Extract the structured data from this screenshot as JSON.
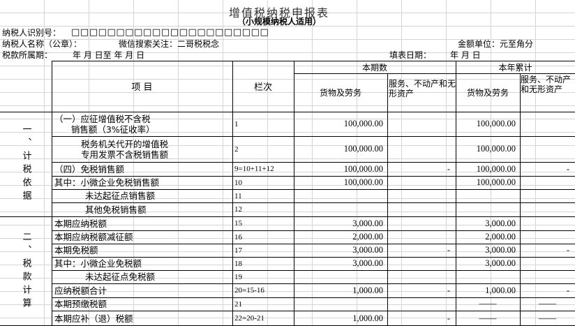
{
  "form": {
    "title": "增值税纳税申报表",
    "subtitle": "（小规模纳税人适用）",
    "taxpayer_id_label": "纳税人识别号：",
    "taxpayer_id_boxes": "□□□□□□□□□□□□□□□□□□□□□□",
    "taxpayer_name_label": "纳税人名称（公章）：",
    "wechat_note": "微信搜索关注：二哥税税念",
    "unit_label": "金额单位：元至角分",
    "period_label": "税款所属期：",
    "period_value": "年  月  日至   年  月  日",
    "fill_date_label": "填表日期：",
    "fill_date_value": "年  月  日"
  },
  "table": {
    "header_item": "项    目",
    "header_line": "栏次",
    "header_current": "本期数",
    "header_ytd": "本年累计",
    "col_goods": "货物及劳务",
    "col_services": "服务、不动产和无形资产",
    "col_services_ytd": "服务、不动产和无形资产",
    "section1": "一、计税依据",
    "section2": "二、税款计算",
    "rows": [
      {
        "item": "（一）应征增值税不含税\n      销售额（3%征收率）",
        "code": "1",
        "g": "100,000.00",
        "s": "",
        "gy": "100,000.00",
        "sy": ""
      },
      {
        "item": "税务机关代开的增值税\n专用发票不含税销售额",
        "code": "2",
        "g": "100,000.00",
        "s": "",
        "gy": "100,000.00",
        "sy": ""
      },
      {
        "item": "（四）免税销售额",
        "code": "9=10+11+12",
        "g": "100,000.00",
        "s": "-",
        "gy": "100,000.00",
        "sy": "-"
      },
      {
        "item": "其中：小微企业免税销售额",
        "code": "10",
        "g": "100,000.00",
        "s": "",
        "gy": "100,000.00",
        "sy": ""
      },
      {
        "item": "未达起征点销售额",
        "code": "11",
        "g": "",
        "s": "",
        "gy": "",
        "sy": ""
      },
      {
        "item": "其他免税销售额",
        "code": "12",
        "g": "",
        "s": "",
        "gy": "",
        "sy": ""
      },
      {
        "item": "本期应纳税额",
        "code": "15",
        "g": "3,000.00",
        "s": "",
        "gy": "3,000.00",
        "sy": ""
      },
      {
        "item": "本期应纳税额减征额",
        "code": "16",
        "g": "2,000.00",
        "s": "",
        "gy": "2,000.00",
        "sy": ""
      },
      {
        "item": "本期免税额",
        "code": "17",
        "g": "3,000.00",
        "s": "-",
        "gy": "3,000.00",
        "sy": "-"
      },
      {
        "item": "其中：小微企业免税额",
        "code": "18",
        "g": "3,000.00",
        "s": "",
        "gy": "3,000.00",
        "sy": ""
      },
      {
        "item": "未达起征点免税额",
        "code": "19",
        "g": "",
        "s": "",
        "gy": "",
        "sy": ""
      },
      {
        "item": "应纳税额合计",
        "code": "20=15-16",
        "g": "1,000.00",
        "s": "-",
        "gy": "1,000.00",
        "sy": "-"
      },
      {
        "item": "本期预缴税额",
        "code": "21",
        "g": "",
        "s": "",
        "gy": "——",
        "sy": "——"
      },
      {
        "item": "本期应补（退）税额",
        "code": "22=20-21",
        "g": "1,000.00",
        "s": "-",
        "gy": "——",
        "sy": "——"
      }
    ]
  }
}
